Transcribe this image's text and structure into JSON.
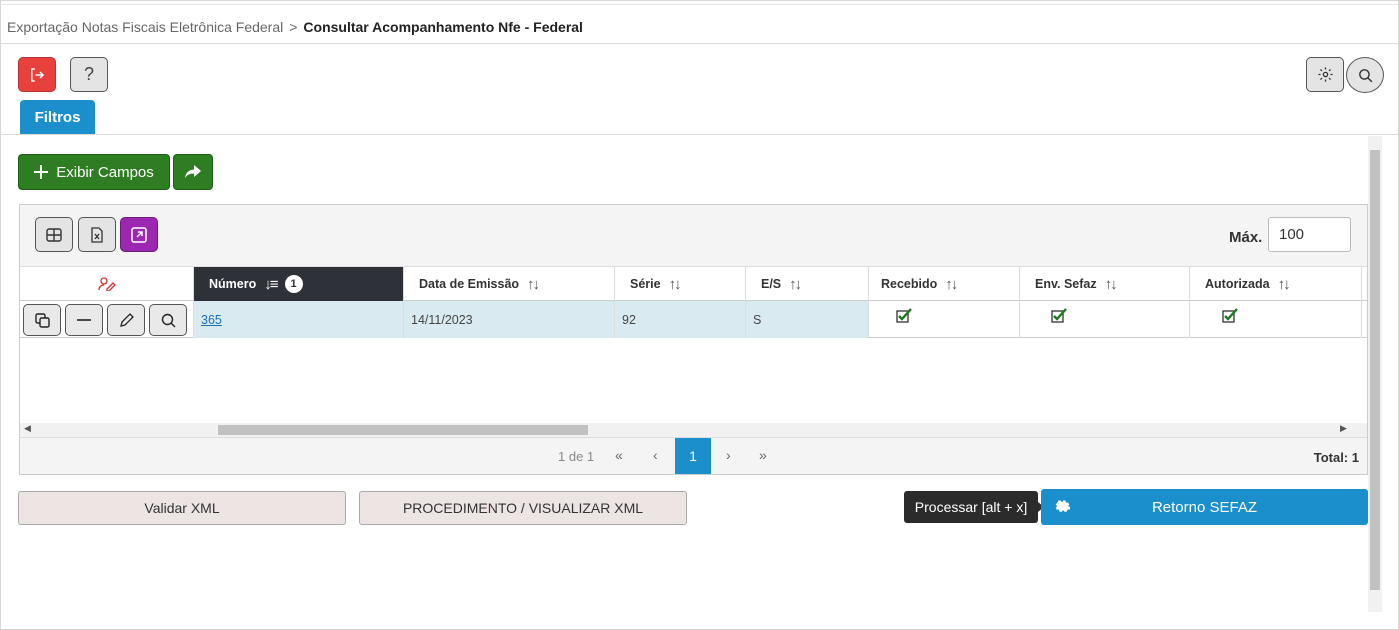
{
  "breadcrumb": {
    "parent": "Exportação Notas Fiscais Eletrônica Federal",
    "separator": ">",
    "current": "Consultar Acompanhamento Nfe - Federal"
  },
  "toolbar": {
    "exit_icon": "logout-icon",
    "help_label": "?",
    "settings_icon": "gear-icon",
    "search_icon": "search-icon"
  },
  "tabs": [
    {
      "label": "Filtros",
      "active": true
    }
  ],
  "actions": {
    "exibir_campos_label": "Exibir Campos",
    "share_icon": "share-icon"
  },
  "grid": {
    "max_label": "Máx.",
    "max_value": "100",
    "columns": [
      {
        "label": "",
        "icon": "user-edit-icon"
      },
      {
        "label": "Número",
        "sorted": true,
        "sort_badge": "1"
      },
      {
        "label": "Data de Emissão"
      },
      {
        "label": "Série"
      },
      {
        "label": "E/S"
      },
      {
        "label": "Recebido"
      },
      {
        "label": "Env. Sefaz"
      },
      {
        "label": "Autorizada"
      }
    ],
    "rows": [
      {
        "numero": "365",
        "data_emissao": "14/11/2023",
        "serie": "92",
        "es": "S",
        "recebido": true,
        "env_sefaz": true,
        "autorizada": true
      }
    ],
    "pager": {
      "info": "1 de 1",
      "first": "«",
      "prev": "‹",
      "current": "1",
      "next": "›",
      "last": "»",
      "total_label": "Total:",
      "total": "1"
    }
  },
  "bottom": {
    "validar_label": "Validar XML",
    "procedimento_label": "PROCEDIMENTO / VISUALIZAR XML",
    "tooltip": "Processar [alt + x]",
    "retorno_label": "Retorno SEFAZ"
  },
  "colors": {
    "accent": "#1a8fcb",
    "danger": "#e8403c",
    "success": "#2e7d22",
    "purple": "#9c27b0",
    "header_dark": "#2e3138"
  }
}
